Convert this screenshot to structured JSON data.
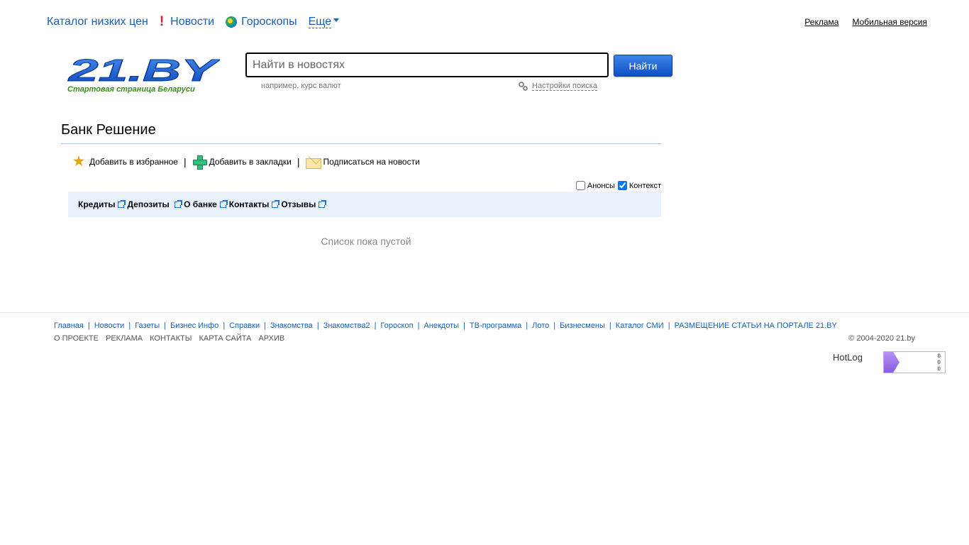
{
  "topnav": {
    "catalog": "Каталог низких цен",
    "news": "Новости",
    "horoscopes": "Гороскопы",
    "more": "Еще"
  },
  "toplinks": {
    "ads": "Реклама",
    "mobile": "Мобильная версия"
  },
  "logo": {
    "text": "21.BY",
    "tagline": "Стартовая страница Беларуси"
  },
  "search": {
    "placeholder": "Найти в новостях",
    "button": "Найти",
    "hint": "например, курс валют",
    "settings": "Настройки поиска"
  },
  "bank": {
    "title": "Банк Решение",
    "actions": {
      "favorite": "Добавить в избранное",
      "bookmarks": "Добавить в закладки",
      "subscribe": "Подписаться на новости"
    },
    "toggles": {
      "announcements": "Анонсы",
      "announcements_checked": false,
      "context": "Контекст",
      "context_checked": true
    },
    "tabs": [
      "Кредиты",
      "Депозиты",
      "О банке",
      "Контакты",
      "Отзывы"
    ],
    "empty": "Список пока пустой"
  },
  "footer": {
    "links": [
      "Главная",
      "Новости",
      "Газеты",
      "Бизнес Инфо",
      "Справки",
      "Знакомства",
      "Знакомства2",
      "Гороскоп",
      "Анекдоты",
      "ТВ-программа",
      "Лото",
      "Бизнесмены",
      "Каталог СМИ",
      "РАЗМЕЩЕНИЕ СТАТЬИ НА ПОРТАЛЕ 21.BY"
    ],
    "secondary": [
      "О ПРОЕКТЕ",
      "РЕКЛАМА",
      "КОНТАКТЫ",
      "КАРТА САЙТА",
      "АРХИВ"
    ],
    "copyright": "© 2004-2020 21.by",
    "hotlog": "HotLog",
    "counter": [
      "0",
      "0",
      "0"
    ]
  },
  "colors": {
    "link": "#1a5fb4",
    "accent_button": "#0d4fc7",
    "tab_bar": "#eaf3fd",
    "tagline": "#3a8c1a"
  }
}
